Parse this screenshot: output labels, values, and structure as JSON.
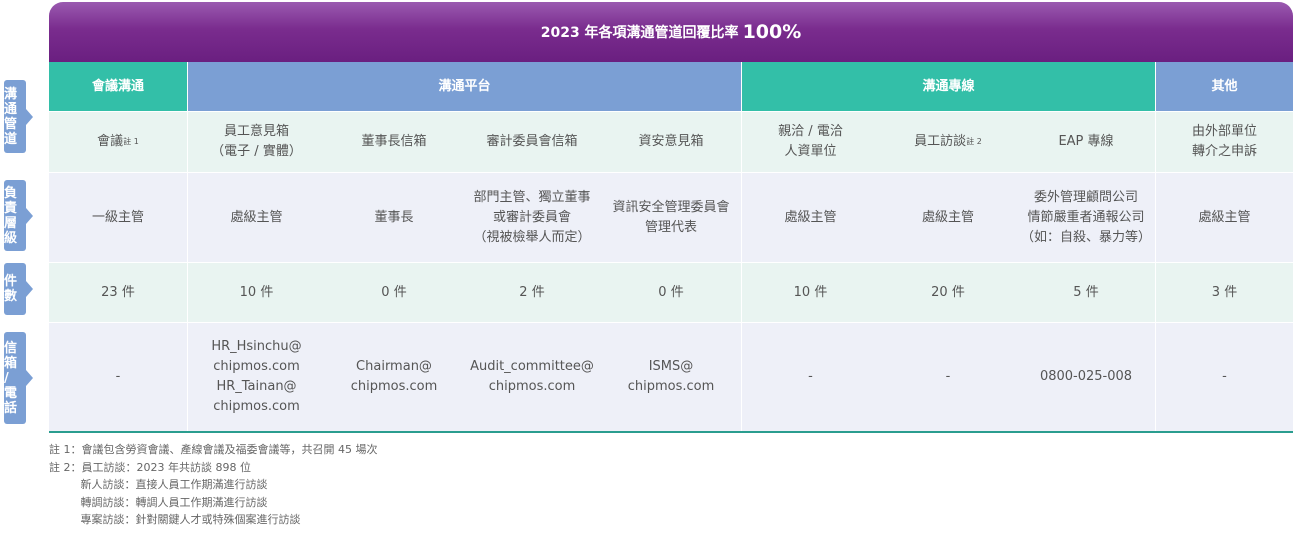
{
  "title": {
    "text": "2023 年各項溝通管道回覆比率",
    "pct": "100%"
  },
  "side_tabs": [
    "溝\n通\n管\n道",
    "負\n責\n層\n級",
    "件\n數",
    "信\n箱\n/\n電\n話"
  ],
  "header": [
    "會議溝通",
    "溝通平台",
    "溝通專線",
    "其他"
  ],
  "channels": [
    "會議",
    "員工意見箱\n（電子 / 實體）",
    "董事長信箱",
    "審計委員會信箱",
    "資安意見箱",
    "親洽 / 電洽\n人資單位",
    "員工訪談",
    "EAP 專線",
    "由外部單位\n轉介之申訴"
  ],
  "channel_notes": {
    "0": "註 1",
    "6": "註 2"
  },
  "levels": [
    "一級主管",
    "處級主管",
    "董事長",
    "部門主管、獨立董事\n或審計委員會\n（視被檢舉人而定）",
    "資訊安全管理委員會\n管理代表",
    "處級主管",
    "處級主管",
    "委外管理顧問公司\n情節嚴重者通報公司\n（如：自殺、暴力等）",
    "處級主管"
  ],
  "counts": [
    "23 件",
    "10 件",
    "0 件",
    "2 件",
    "0 件",
    "10 件",
    "20 件",
    "5 件",
    "3 件"
  ],
  "contacts": [
    "-",
    "HR_Hsinchu@\nchipmos.com\nHR_Tainan@\nchipmos.com",
    "Chairman@\nchipmos.com",
    "Audit_committee@\nchipmos.com",
    "ISMS@\nchipmos.com",
    "-",
    "-",
    "0800-025-008",
    "-"
  ],
  "notes": [
    "註 1：會議包含勞資會議、產線會議及福委會議等，共召開 45 場次",
    "註 2：員工訪談：2023 年共訪談 898 位",
    "         新人訪談：直接人員工作期滿進行訪談",
    "         轉調訪談：轉調人員工作期滿進行訪談",
    "         專案訪談：針對關鍵人才或特殊個案進行訪談"
  ],
  "colors": {
    "title": "#7a2c8e",
    "teal": "#33bfa8",
    "blue": "#7b9fd4",
    "row_mint": "#e9f4f1",
    "row_lav": "#eef0f8"
  }
}
